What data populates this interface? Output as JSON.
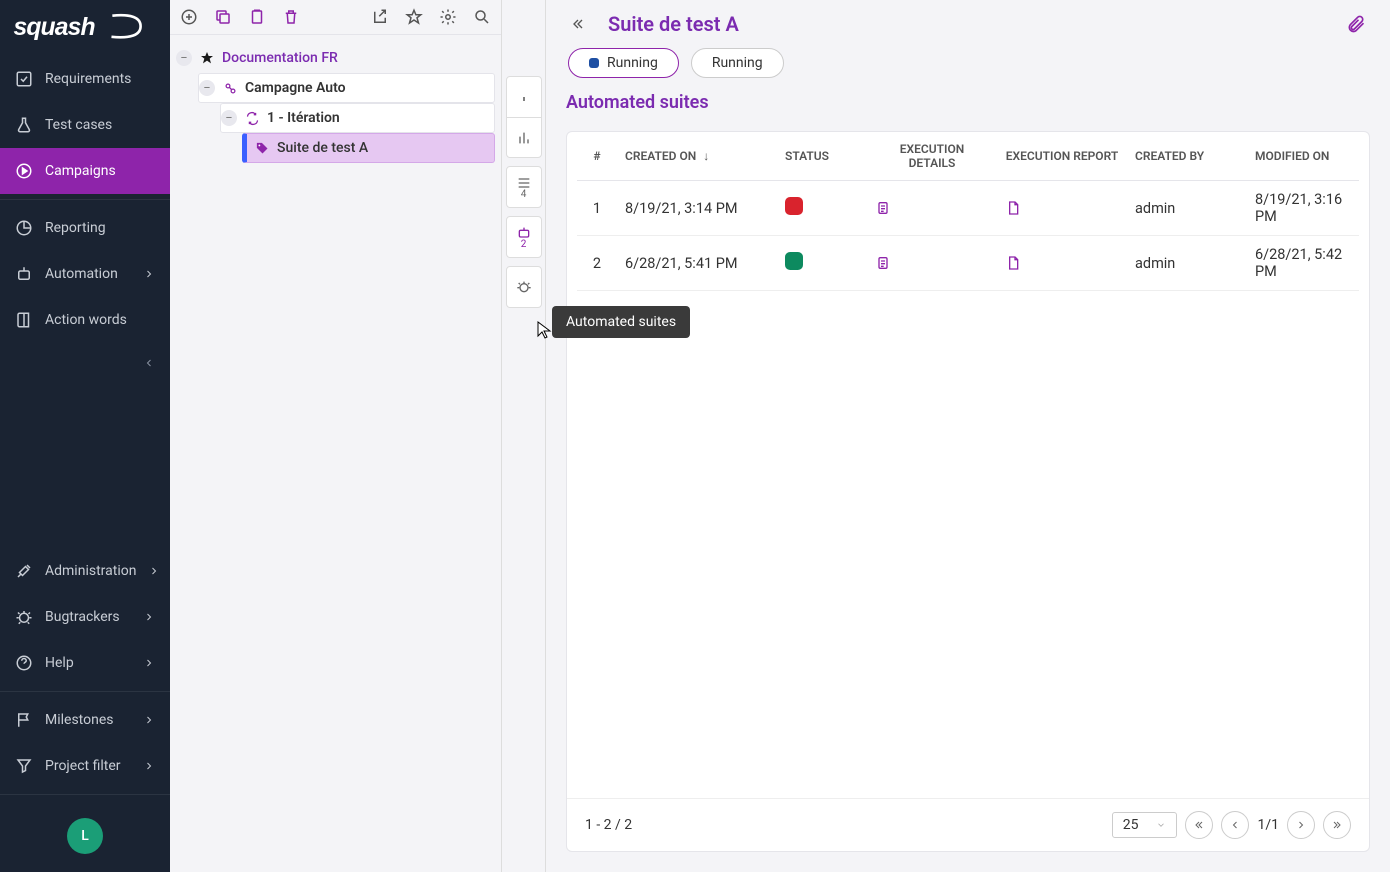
{
  "app": {
    "name": "squash"
  },
  "sidebar": {
    "items": {
      "requirements": "Requirements",
      "testcases": "Test cases",
      "campaigns": "Campaigns",
      "reporting": "Reporting",
      "automation": "Automation",
      "actionwords": "Action words",
      "administration": "Administration",
      "bugtrackers": "Bugtrackers",
      "help": "Help",
      "milestones": "Milestones",
      "projectfilter": "Project filter"
    },
    "avatar": "L"
  },
  "tree": {
    "project": "Documentation FR",
    "campaign": "Campagne Auto",
    "iteration": "1 - Itération",
    "suite": "Suite de test A"
  },
  "subnav": {
    "list_badge": "4",
    "robot_badge": "2",
    "tooltip": "Automated suites"
  },
  "page": {
    "title": "Suite de test A",
    "pill1": "Running",
    "pill2": "Running",
    "section": "Automated suites"
  },
  "table": {
    "headers": {
      "num": "#",
      "created": "CREATED ON",
      "status": "STATUS",
      "exec_details": "EXECUTION DETAILS",
      "exec_report": "EXECUTION REPORT",
      "created_by": "CREATED BY",
      "modified": "MODIFIED ON"
    },
    "rows": [
      {
        "num": "1",
        "created": "8/19/21, 3:14 PM",
        "status_color": "#d9232d",
        "created_by": "admin",
        "modified": "8/19/21, 3:16 PM"
      },
      {
        "num": "2",
        "created": "6/28/21, 5:41 PM",
        "status_color": "#0d8a5f",
        "created_by": "admin",
        "modified": "6/28/21, 5:42 PM"
      }
    ]
  },
  "footer": {
    "range": "1 - 2 / 2",
    "page_size": "25",
    "page_info": "1/1"
  }
}
